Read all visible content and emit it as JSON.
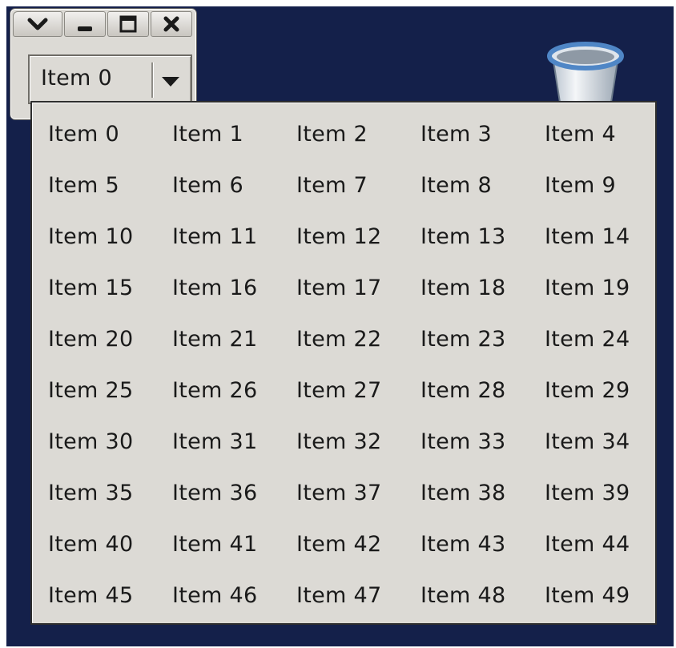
{
  "window": {
    "titlebar_icons": [
      "chevron-down-icon",
      "minimize-icon",
      "maximize-icon",
      "close-icon"
    ],
    "combo": {
      "selected": "Item 0",
      "arrow_icon": "triangle-down-icon"
    }
  },
  "desktop": {
    "background_color": "#14204a",
    "icons": [
      "trash-icon"
    ]
  },
  "popup": {
    "columns": 5,
    "items": [
      "Item 0",
      "Item 1",
      "Item 2",
      "Item 3",
      "Item 4",
      "Item 5",
      "Item 6",
      "Item 7",
      "Item 8",
      "Item 9",
      "Item 10",
      "Item 11",
      "Item 12",
      "Item 13",
      "Item 14",
      "Item 15",
      "Item 16",
      "Item 17",
      "Item 18",
      "Item 19",
      "Item 20",
      "Item 21",
      "Item 22",
      "Item 23",
      "Item 24",
      "Item 25",
      "Item 26",
      "Item 27",
      "Item 28",
      "Item 29",
      "Item 30",
      "Item 31",
      "Item 32",
      "Item 33",
      "Item 34",
      "Item 35",
      "Item 36",
      "Item 37",
      "Item 38",
      "Item 39",
      "Item 40",
      "Item 41",
      "Item 42",
      "Item 43",
      "Item 44",
      "Item 45",
      "Item 46",
      "Item 47",
      "Item 48",
      "Item 49"
    ]
  }
}
